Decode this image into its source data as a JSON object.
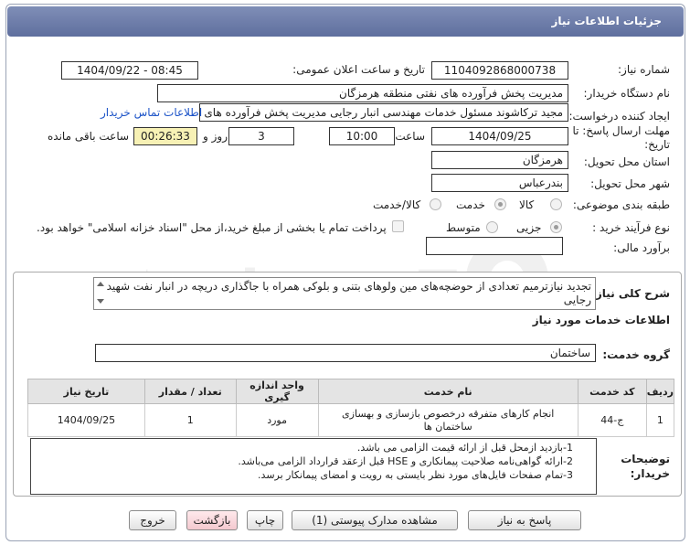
{
  "header": {
    "title": "جزئیات اطلاعات نیاز"
  },
  "fields": {
    "need_number": {
      "label": "شماره نیاز:",
      "value": "1104092868000738"
    },
    "announce_datetime": {
      "label": "تاریخ و ساعت اعلان عمومی:",
      "value": "1404/09/22 - 08:45"
    },
    "buyer_org": {
      "label": "نام دستگاه خریدار:",
      "value": "مدیریت پخش فرآورده های نفتی منطقه هرمزگان"
    },
    "requester": {
      "label": "ایجاد کننده درخواست:",
      "value": "مجید ترکاشوند مسئول خدمات مهندسی انبار رجایی مدیریت پخش فرآورده های",
      "link": "اطلاعات تماس خریدار"
    },
    "deadline": {
      "label": "مهلت ارسال پاسخ: تا تاریخ:",
      "date": "1404/09/25",
      "time_label": "ساعت",
      "time": "10:00",
      "days": "3",
      "days_label": "روز و",
      "remaining": "00:26:33",
      "remaining_label": "ساعت باقی مانده"
    },
    "province": {
      "label": "استان محل تحویل:",
      "value": "هرمزگان"
    },
    "city": {
      "label": "شهر محل تحویل:",
      "value": "بندرعباس"
    },
    "category": {
      "label": "طبقه بندی موضوعی:",
      "options": [
        "کالا",
        "خدمت",
        "کالا/خدمت"
      ],
      "selected": "خدمت"
    },
    "purchase_type": {
      "label": "نوع فرآیند خرید :",
      "options": [
        "جزیی",
        "متوسط"
      ],
      "selected": "جزیی",
      "payment_note": "پرداخت تمام یا بخشی از مبلغ خرید،از محل \"اسناد خزانه اسلامی\" خواهد بود."
    },
    "budget": {
      "label": "برآورد مالی:",
      "value": ""
    }
  },
  "general_description": {
    "label": "شرح کلی نیاز:",
    "value": "تجدید نیازترمیم تعدادی از حوضچه‌های مین ولوهای بتنی و بلوکی همراه با جاگذاری دریچه در انبار نفت شهید رجایی"
  },
  "services": {
    "title": "اطلاعات خدمات مورد نیاز",
    "group_label": "گروه خدمت:",
    "group_value": "ساختمان",
    "columns": [
      "ردیف",
      "کد خدمت",
      "نام خدمت",
      "واحد اندازه گیری",
      "تعداد / مقدار",
      "تاریخ نیاز"
    ],
    "rows": [
      {
        "index": "1",
        "code": "ج-44",
        "name": "انجام کارهای متفرقه درخصوص بازسازی و بهسازی ساختمان ها",
        "unit": "مورد",
        "qty": "1",
        "date": "1404/09/25"
      }
    ]
  },
  "buyer_notes": {
    "label": "توضیحات خریدار:",
    "lines": [
      {
        "num": "1-",
        "text": "بازدید ازمحل قبل از ارائه قیمت الزامی می باشد."
      },
      {
        "num": "2-",
        "text": "ارائه گواهی‌نامه صلاحیت پیمانکاری و HSE  قبل ازعقد قرارداد الزامی می‌باشد."
      },
      {
        "num": "3-",
        "text": "تمام صفحات فایل‌های مورد نظر بایستی به رویت و امضای پیمانکار برسد."
      }
    ]
  },
  "buttons": {
    "reply": "پاسخ به نیاز",
    "attachments": "مشاهده مدارک پیوستی (1)",
    "print": "چاپ",
    "back": "بازگشت",
    "exit": "خروج"
  },
  "watermark": {
    "text": "AriaTender.neT"
  },
  "colors": {
    "header": "#6b7aa8",
    "remaining_bg": "#f7f1b5",
    "link": "#1d54c8"
  }
}
